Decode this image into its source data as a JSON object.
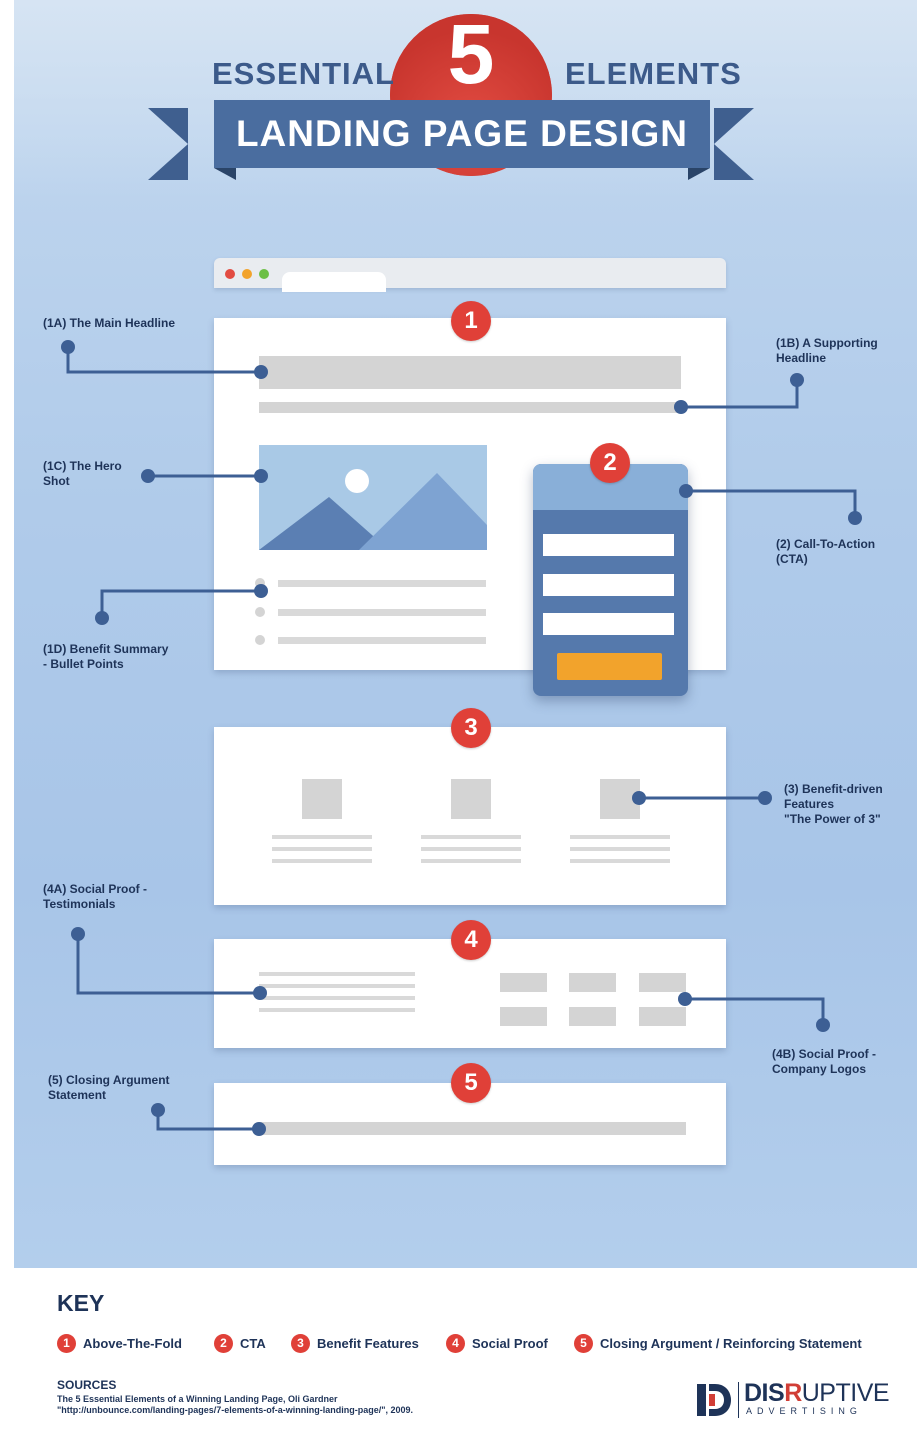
{
  "header": {
    "essential": "ESSENTIAL",
    "number": "5",
    "elements": "ELEMENTS",
    "ribbon_title": "LANDING PAGE DESIGN"
  },
  "badges": [
    "1",
    "2",
    "3",
    "4",
    "5"
  ],
  "callouts": {
    "main_headline": "(1A) The Main Headline",
    "supporting_headline": "(1B) A Supporting\nHeadline",
    "hero_shot": "(1C) The Hero\nShot",
    "benefit_summary": "(1D) Benefit Summary\n- Bullet Points",
    "cta": "(2) Call-To-Action\n(CTA)",
    "benefit_features": "(3) Benefit-driven\nFeatures\n\"The Power of 3\"",
    "testimonials": "(4A) Social Proof -\nTestimonials",
    "company_logos": "(4B) Social Proof -\nCompany Logos",
    "closing_argument": "(5) Closing Argument\nStatement"
  },
  "key": {
    "heading": "KEY",
    "items": [
      {
        "num": "1",
        "label": "Above-The-Fold"
      },
      {
        "num": "2",
        "label": "CTA"
      },
      {
        "num": "3",
        "label": "Benefit Features"
      },
      {
        "num": "4",
        "label": "Social Proof"
      },
      {
        "num": "5",
        "label": "Closing Argument / Reinforcing Statement"
      }
    ]
  },
  "sources": {
    "heading": "SOURCES",
    "text": "The 5 Essential Elements of a Winning Landing Page, Oli Gardner\n\"http://unbounce.com/landing-pages/7-elements-of-a-winning-landing-page/\", 2009."
  },
  "logo": {
    "word_bold": "DIS",
    "word_red": "R",
    "word_rest": "UPTIVE",
    "sub": "ADVERTISING"
  },
  "colors": {
    "accent_red": "#e04038",
    "navy": "#1e3358",
    "ribbon_blue": "#4a6d9f",
    "cta_orange": "#f2a32c",
    "background_blue": "#b0cbea"
  }
}
